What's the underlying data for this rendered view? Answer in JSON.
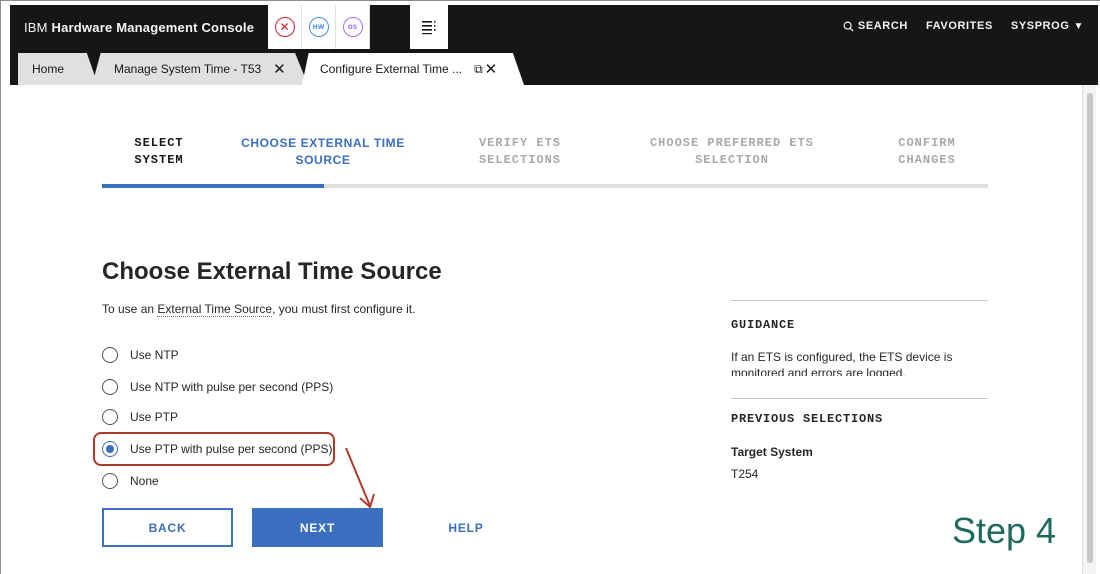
{
  "app": {
    "brand_prefix": "IBM",
    "brand_name": "Hardware Management Console",
    "status_icons": [
      {
        "icon": "error-x-icon",
        "color": "#da1e28"
      },
      {
        "icon": "hardware-icon",
        "text": "HW",
        "color": "#4589ff"
      },
      {
        "icon": "os-icon",
        "text": "OS",
        "color": "#a56eff"
      }
    ],
    "menu_icon": "task-list-icon",
    "header_links": {
      "search": "SEARCH",
      "favorites": "FAVORITES",
      "user": "SYSPROG"
    }
  },
  "tabs": [
    {
      "label": "Home"
    },
    {
      "label": "Manage System Time - T53",
      "close": "✕"
    },
    {
      "label": "Configure External Time ...",
      "close": "✕",
      "popout": "⧉"
    }
  ],
  "wizard": {
    "steps": [
      {
        "line1": "SELECT",
        "line2": "SYSTEM",
        "state": "done"
      },
      {
        "line1": "CHOOSE EXTERNAL TIME",
        "line2": "SOURCE",
        "state": "current"
      },
      {
        "line1": "VERIFY ETS",
        "line2": "SELECTIONS",
        "state": "pending"
      },
      {
        "line1": "CHOOSE PREFERRED ETS",
        "line2": "SELECTION",
        "state": "pending"
      },
      {
        "line1": "CONFIRM",
        "line2": "CHANGES",
        "state": "pending"
      }
    ],
    "progress_fraction": 0.25,
    "accent_color": "#3a6fc0"
  },
  "main": {
    "title": "Choose External Time Source",
    "intro_before": "To use an ",
    "intro_term": "External Time Source",
    "intro_after": ", you must first configure it.",
    "options": [
      {
        "label": "Use NTP",
        "checked": false
      },
      {
        "label": "Use NTP with pulse per second (PPS)",
        "checked": false
      },
      {
        "label": "Use PTP",
        "checked": false
      },
      {
        "label": "Use PTP with pulse per second (PPS)",
        "checked": true
      },
      {
        "label": "None",
        "checked": false
      }
    ],
    "buttons": {
      "back": "BACK",
      "next": "NEXT",
      "help": "HELP"
    }
  },
  "sidebar": {
    "guidance_heading": "GUIDANCE",
    "guidance_text": "If an ETS is configured, the ETS device is monitored and errors are logged.",
    "previous_heading": "PREVIOUS SELECTIONS",
    "target_label": "Target System",
    "target_value": "T254"
  },
  "annotation": {
    "step_label": "Step 4",
    "highlight_color": "#b0392c",
    "step_color": "#1f6b5b"
  }
}
